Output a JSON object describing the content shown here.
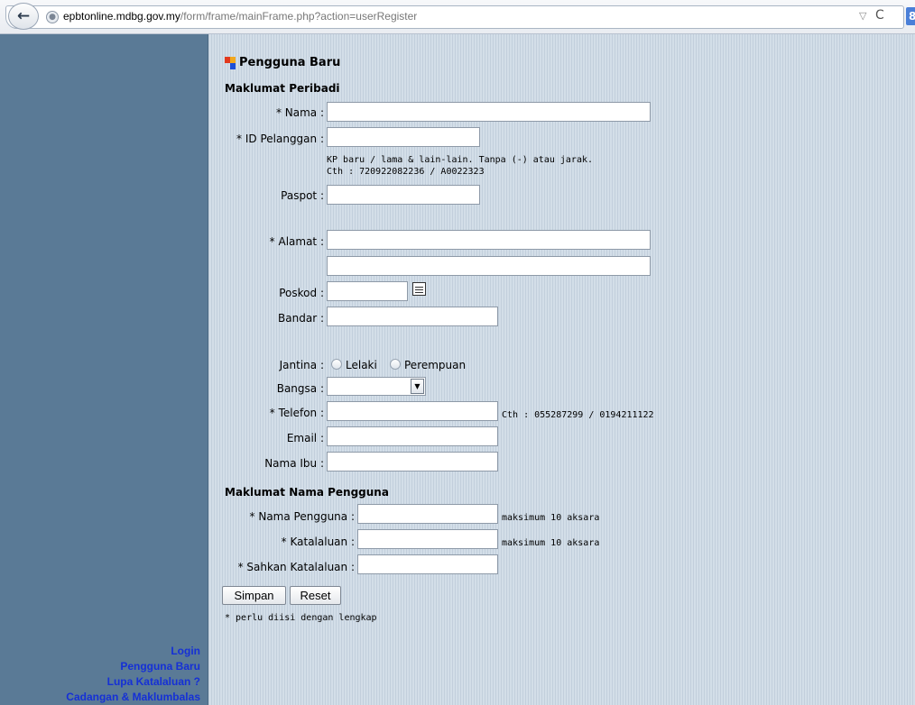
{
  "browser": {
    "url_host": "epbtonline.mdbg.gov.my",
    "url_path": "/form/frame/mainFrame.php?action=userRegister",
    "url_prefix": ""
  },
  "page": {
    "title": "Pengguna Baru"
  },
  "sections": {
    "personal": "Maklumat Peribadi",
    "username": "Maklumat Nama Pengguna"
  },
  "fields": {
    "nama": {
      "label": "* Nama :",
      "value": ""
    },
    "id_pelanggan": {
      "label": "* ID Pelanggan :",
      "value": "",
      "hint1": "KP baru / lama & lain-lain. Tanpa (-) atau jarak.",
      "hint2": "Cth : 720922082236 / A0022323"
    },
    "paspot": {
      "label": "Paspot :",
      "value": ""
    },
    "alamat": {
      "label": "* Alamat :",
      "value1": "",
      "value2": ""
    },
    "poskod": {
      "label": "Poskod :",
      "value": ""
    },
    "bandar": {
      "label": "Bandar :",
      "value": ""
    },
    "jantina": {
      "label": "Jantina :",
      "option1": "Lelaki",
      "option2": "Perempuan"
    },
    "bangsa": {
      "label": "Bangsa :",
      "value": ""
    },
    "telefon": {
      "label": "* Telefon :",
      "value": "",
      "hint": "Cth : 055287299 / 0194211122"
    },
    "email": {
      "label": "Email :",
      "value": ""
    },
    "nama_ibu": {
      "label": "Nama Ibu :",
      "value": ""
    },
    "nama_pengguna": {
      "label": "* Nama Pengguna :",
      "value": "",
      "hint": "maksimum 10 aksara"
    },
    "katalaluan": {
      "label": "* Katalaluan :",
      "value": "",
      "hint": "maksimum 10 aksara"
    },
    "sahkan": {
      "label": "* Sahkan Katalaluan :",
      "value": ""
    }
  },
  "buttons": {
    "simpan": "Simpan",
    "reset": "Reset"
  },
  "note": "* perlu diisi dengan lengkap",
  "sidebar": {
    "links": [
      "Login",
      "Pengguna Baru",
      "Lupa Katalaluan ?",
      "Cadangan & Maklumbalas"
    ]
  },
  "colors": {
    "sidebar_bg": "#5a7a96",
    "link": "#1530d6",
    "main_bg": "#cbd7e2"
  },
  "icons": [
    "back-arrow-icon",
    "globe-icon",
    "calendar-icon",
    "reload-icon",
    "dropdown-arrow-icon"
  ]
}
